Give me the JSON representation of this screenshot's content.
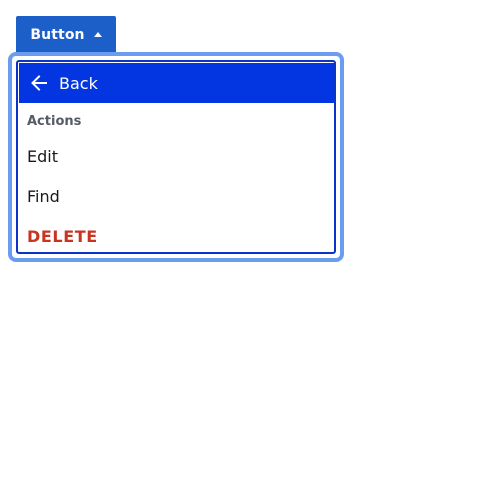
{
  "trigger": {
    "label": "Button",
    "icon": "caret-up-icon"
  },
  "menu": {
    "back": {
      "label": "Back",
      "icon": "arrow-left-icon"
    },
    "section_heading": "Actions",
    "items": [
      {
        "label": "Edit"
      },
      {
        "label": "Find"
      },
      {
        "label": "DELETE",
        "variant": "danger"
      }
    ]
  },
  "colors": {
    "primary": "#1c5fc9",
    "highlight": "#0336e0",
    "focus_ring": "#6b9cf0",
    "danger": "#c93420",
    "muted": "#555c66"
  }
}
